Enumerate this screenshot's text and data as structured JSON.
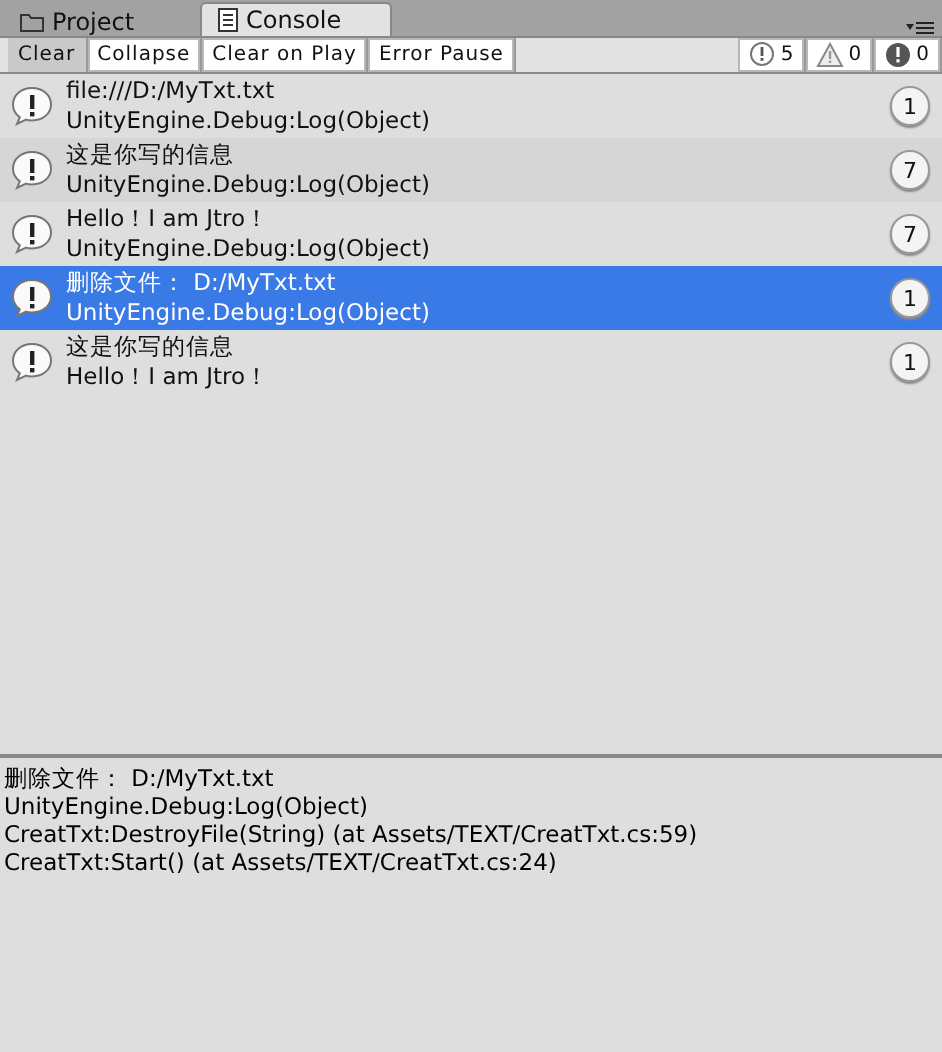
{
  "tabs": [
    {
      "label": "Project",
      "kind": "folder",
      "selected": false
    },
    {
      "label": "Console",
      "kind": "document",
      "selected": true
    }
  ],
  "toolbar": {
    "buttons": [
      {
        "label": "Clear",
        "on": false
      },
      {
        "label": "Collapse",
        "on": true
      },
      {
        "label": "Clear on Play",
        "on": true
      },
      {
        "label": "Error Pause",
        "on": true
      }
    ],
    "counters": [
      {
        "kind": "info",
        "count": "5"
      },
      {
        "kind": "warning",
        "count": "0"
      },
      {
        "kind": "error",
        "count": "0"
      }
    ]
  },
  "entries": [
    {
      "line_1": "file:///D:/MyTxt.txt",
      "line_2": "UnityEngine.Debug:Log(Object)",
      "count": "1",
      "selected": false
    },
    {
      "line_1": "这是你写的信息",
      "line_2": "UnityEngine.Debug:Log(Object)",
      "count": "7",
      "selected": false
    },
    {
      "line_1": "Hello！I am Jtro！",
      "line_2": "UnityEngine.Debug:Log(Object)",
      "count": "7",
      "selected": false
    },
    {
      "line_1": "删除文件： D:/MyTxt.txt",
      "line_2": "UnityEngine.Debug:Log(Object)",
      "count": "1",
      "selected": true
    },
    {
      "line_1": "这是你写的信息",
      "line_2": "Hello！I am Jtro！",
      "count": "1",
      "selected": false
    }
  ],
  "details": [
    "删除文件： D:/MyTxt.txt",
    "UnityEngine.Debug:Log(Object)",
    "CreatTxt:DestroyFile(String) (at Assets/TEXT/CreatTxt.cs:59)",
    "CreatTxt:Start() (at Assets/TEXT/CreatTxt.cs:24)"
  ]
}
